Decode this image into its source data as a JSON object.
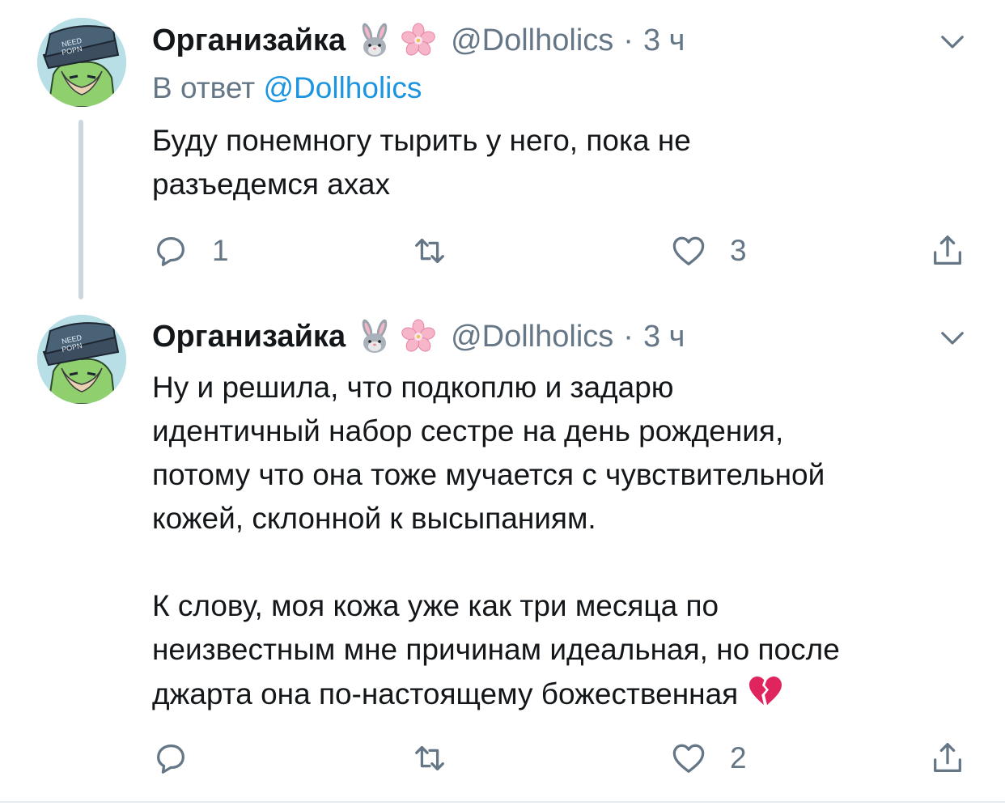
{
  "tweets": [
    {
      "author_name": "Организайка",
      "author_emojis": [
        "rabbit-face",
        "cherry-blossom"
      ],
      "handle": "@Dollholics",
      "separator": "·",
      "time": "3 ч",
      "reply_prefix": "В ответ",
      "reply_mention": "@Dollholics",
      "text": "Буду понемногу тырить у него, пока не\nразъедемся ахах",
      "replies": "1",
      "retweets": "",
      "likes": "3",
      "icons": [
        "reply-icon",
        "retweet-icon",
        "like-icon",
        "share-icon",
        "chevron-down-icon"
      ]
    },
    {
      "author_name": "Организайка",
      "author_emojis": [
        "rabbit-face",
        "cherry-blossom"
      ],
      "handle": "@Dollholics",
      "separator": "·",
      "time": "3 ч",
      "text": "Ну и решила, что подкоплю и задарю\nидентичный набор сестре на день рождения,\nпотому что она тоже мучается с чувствительной\nкожей, склонной к высыпаниям.\n\nК слову, моя кожа уже как три месяца по\nнеизвестным мне причинам идеальная, но после\nджарта она по-настоящему божественная",
      "end_emoji": "broken-heart",
      "replies": "",
      "retweets": "",
      "likes": "2",
      "icons": [
        "reply-icon",
        "retweet-icon",
        "like-icon",
        "share-icon",
        "chevron-down-icon"
      ]
    }
  ],
  "colors": {
    "text": "#14171a",
    "secondary": "#657786",
    "link": "#1b95e0",
    "thread_line": "#ccd6dd",
    "divider": "#e6ecf0",
    "broken_heart": "#e0245e"
  }
}
